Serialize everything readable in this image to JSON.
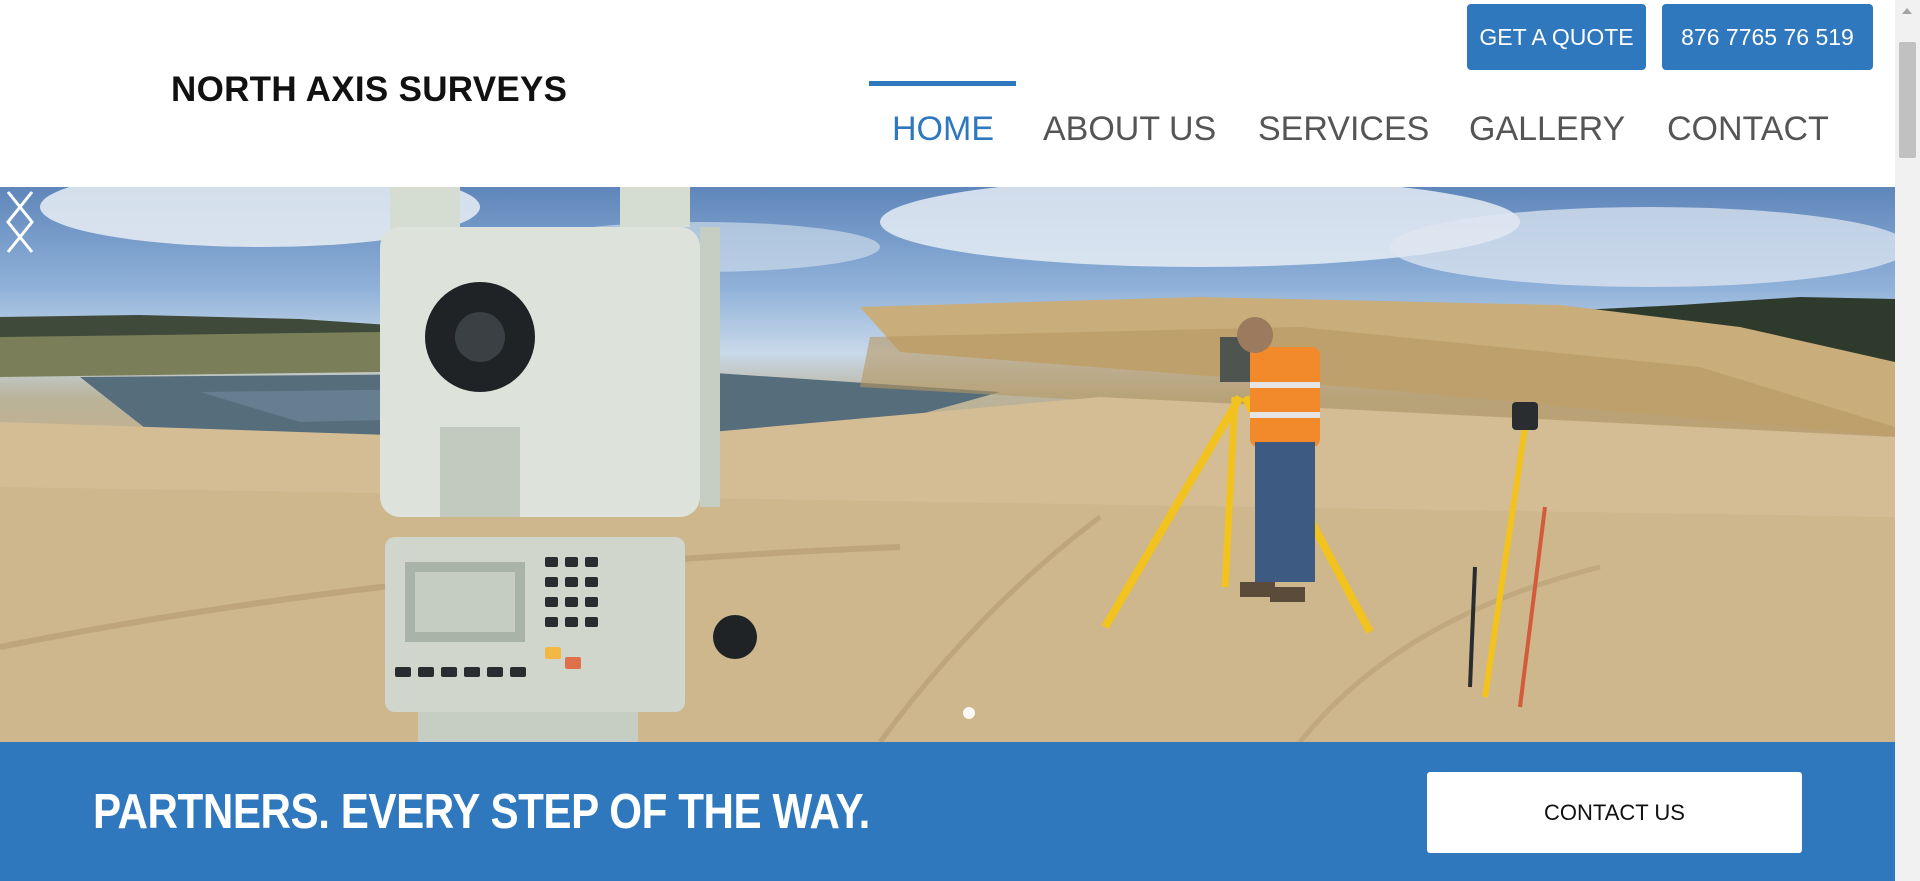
{
  "header": {
    "logo": "NORTH AXIS SURVEYS",
    "quote_button": "GET A QUOTE",
    "phone_button": "876 7765 76 519"
  },
  "nav": {
    "items": [
      {
        "label": "HOME",
        "active": true
      },
      {
        "label": "ABOUT US",
        "active": false
      },
      {
        "label": "SERVICES",
        "active": false
      },
      {
        "label": "GALLERY",
        "active": false
      },
      {
        "label": "CONTACT",
        "active": false
      }
    ]
  },
  "hero": {
    "image": "surveyor with total station on sandy construction site",
    "left_arrow": "chevron-left-icon",
    "right_arrow": "chevron-right-icon",
    "slide_count": 1,
    "active_slide": 1
  },
  "cta": {
    "tagline": "PARTNERS. EVERY STEP OF THE WAY.",
    "button": "CONTACT US"
  },
  "colors": {
    "accent": "#2f78bd",
    "nav_text": "#555555",
    "logo_text": "#111111"
  }
}
